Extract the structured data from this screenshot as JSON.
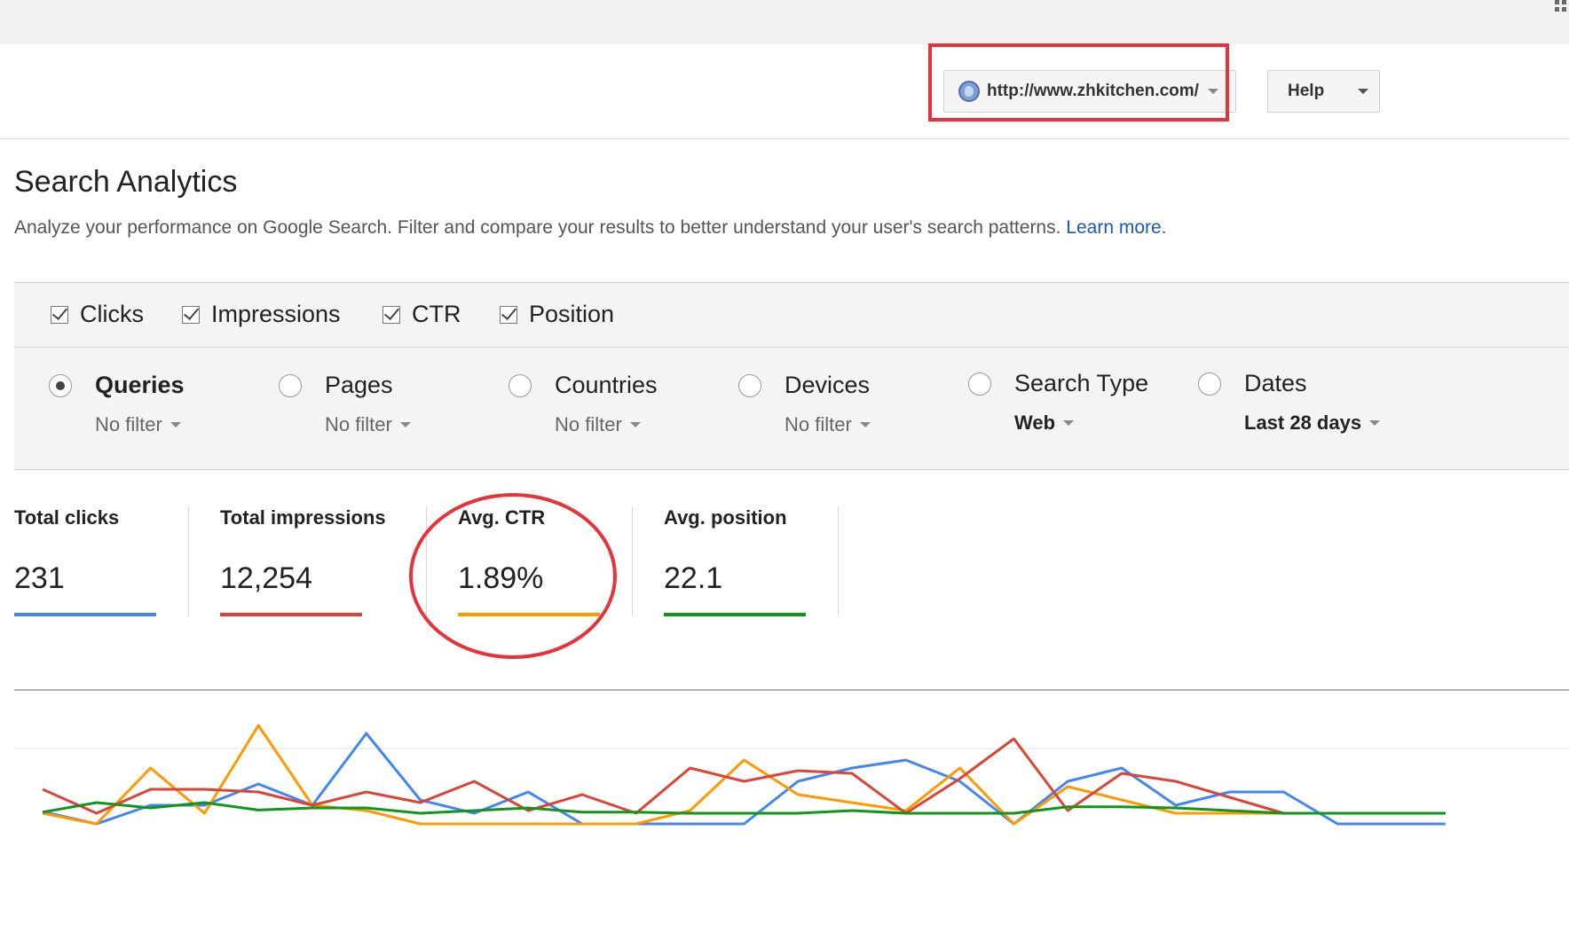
{
  "header": {
    "site_url": "http://www.zhkitchen.com/",
    "help_label": "Help"
  },
  "page": {
    "title": "Search Analytics",
    "description": "Analyze your performance on Google Search. Filter and compare your results to better understand your user's search patterns.",
    "learn_more": "Learn more."
  },
  "metrics": [
    {
      "label": "Clicks",
      "checked": true
    },
    {
      "label": "Impressions",
      "checked": true
    },
    {
      "label": "CTR",
      "checked": true
    },
    {
      "label": "Position",
      "checked": true
    }
  ],
  "dimensions": [
    {
      "label": "Queries",
      "filter": "No filter",
      "selected": true
    },
    {
      "label": "Pages",
      "filter": "No filter",
      "selected": false
    },
    {
      "label": "Countries",
      "filter": "No filter",
      "selected": false
    },
    {
      "label": "Devices",
      "filter": "No filter",
      "selected": false
    },
    {
      "label": "Search Type",
      "filter": "Web",
      "selected": false
    },
    {
      "label": "Dates",
      "filter": "Last 28 days",
      "selected": false
    }
  ],
  "stats": [
    {
      "label": "Total clicks",
      "value": "231",
      "color": "#4285f4"
    },
    {
      "label": "Total impressions",
      "value": "12,254",
      "color": "#db4437"
    },
    {
      "label": "Avg. CTR",
      "value": "1.89%",
      "color": "#ff9900"
    },
    {
      "label": "Avg. position",
      "value": "22.1",
      "color": "#109618"
    }
  ],
  "colors": {
    "clicks": "#4285f4",
    "impressions": "#db4437",
    "ctr": "#ff9900",
    "position": "#109618",
    "annotation": "#e8323b",
    "link": "#1a56c7"
  },
  "chart_data": {
    "type": "line",
    "title": "",
    "xlabel": "",
    "ylabel": "",
    "ylim": [
      0,
      2
    ],
    "grid": true,
    "legend": "none",
    "x": [
      1,
      2,
      3,
      4,
      5,
      6,
      7,
      8,
      9,
      10,
      11,
      12,
      13,
      14,
      15,
      16,
      17,
      18,
      19,
      20,
      21,
      22,
      23,
      24,
      25,
      26,
      27
    ],
    "series": [
      {
        "key": "clicks",
        "values": [
          0.03,
          -0.2,
          0.15,
          0.15,
          0.55,
          0.15,
          1.5,
          0.25,
          0.0,
          0.4,
          -0.2,
          -0.2,
          -0.2,
          -0.2,
          0.6,
          0.85,
          1.0,
          0.6,
          -0.2,
          0.6,
          0.85,
          0.15,
          0.4,
          0.4,
          -0.2,
          -0.2,
          -0.2
        ]
      },
      {
        "key": "impressions",
        "values": [
          0.45,
          0.0,
          0.45,
          0.45,
          0.4,
          0.15,
          0.4,
          0.2,
          0.6,
          0.05,
          0.35,
          0.0,
          0.85,
          0.6,
          0.8,
          0.75,
          0.0,
          0.65,
          1.4,
          0.05,
          0.75,
          0.6,
          0.3,
          0.0,
          0.0,
          0.0,
          0.0
        ]
      },
      {
        "key": "ctr",
        "values": [
          0.0,
          -0.2,
          0.85,
          0.0,
          1.65,
          0.15,
          0.05,
          -0.2,
          -0.2,
          -0.2,
          -0.2,
          -0.2,
          0.05,
          1.0,
          0.35,
          0.2,
          0.05,
          0.85,
          -0.2,
          0.5,
          0.25,
          0.0,
          0.0,
          0.0,
          0.0,
          0.0,
          0.0
        ]
      },
      {
        "key": "position",
        "values": [
          0.02,
          0.2,
          0.1,
          0.2,
          0.06,
          0.1,
          0.1,
          0.0,
          0.05,
          0.1,
          0.02,
          0.02,
          0.0,
          0.0,
          0.0,
          0.05,
          0.0,
          0.0,
          0.0,
          0.12,
          0.12,
          0.1,
          0.05,
          0.0,
          0.0,
          0.0,
          0.0
        ]
      }
    ]
  }
}
